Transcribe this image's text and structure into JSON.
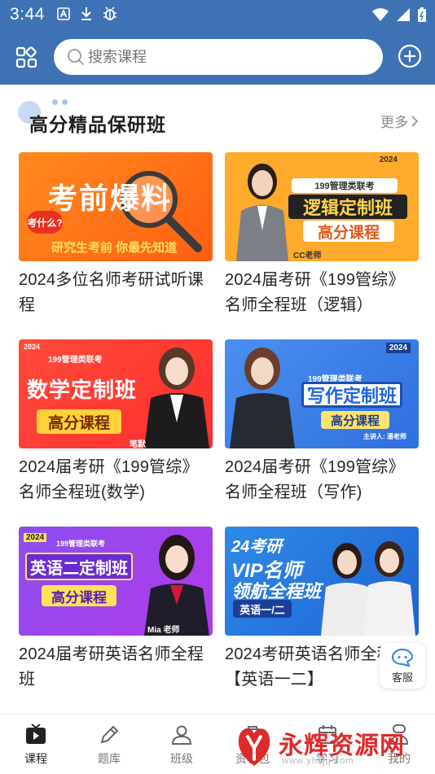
{
  "status_bar": {
    "time": "3:44",
    "left_icons": [
      "text-a-icon",
      "download-icon",
      "bug-icon"
    ],
    "right_icons": [
      "wifi-icon",
      "signal-icon",
      "battery-icon"
    ]
  },
  "header": {
    "search_placeholder": "搜索课程",
    "left_icon": "grid-icon",
    "right_icon": "add-circle-icon"
  },
  "section": {
    "title": "高分精品保研班",
    "more_label": "更多"
  },
  "courses": [
    {
      "title": "2024多位名师考研试听课程",
      "thumb": {
        "main": "考前爆料",
        "sub": "研究生考前 你最先知道",
        "badge": "考什么?"
      }
    },
    {
      "title": "2024届考研《199管综》名师全程班（逻辑）",
      "thumb": {
        "year": "2024",
        "top": "199管理类联考",
        "line1": "逻辑定制班",
        "line2": "高分课程",
        "teacher": "CC老师"
      }
    },
    {
      "title": "2024届考研《199管综》名师全程班(数学)",
      "thumb": {
        "year": "2024",
        "top": "199管理类联考",
        "line1": "数学定制班",
        "line2": "高分课程",
        "teacher": "笔默"
      }
    },
    {
      "title": "2024届考研《199管综》名师全程班（写作)",
      "thumb": {
        "year": "2024",
        "top": "199管理类联考",
        "line1": "写作定制班",
        "line2": "高分课程",
        "teacher": "主讲人: 潘老师"
      }
    },
    {
      "title": "2024届考研英语名师全程班",
      "thumb": {
        "year": "2024",
        "top": "199管理类联考",
        "line1": "英语二定制班",
        "line2": "高分课程",
        "teacher": "Mia 老师"
      }
    },
    {
      "title": "2024考研英语名师全程班【英语一二】",
      "thumb": {
        "l1": "24考研",
        "l2": "VIP名师",
        "l3": "领航全程班",
        "tag": "英语一/二"
      }
    }
  ],
  "service": {
    "label": "客服",
    "icon": "chat-bubble-icon"
  },
  "bottom_nav": [
    {
      "label": "课程",
      "icon": "tv-icon",
      "active": true
    },
    {
      "label": "题库",
      "icon": "pencil-icon",
      "active": false
    },
    {
      "label": "班级",
      "icon": "people-icon",
      "active": false
    },
    {
      "label": "资料包",
      "icon": "package-icon",
      "active": false
    },
    {
      "label": "学习",
      "icon": "calendar-icon",
      "active": false
    },
    {
      "label": "我的",
      "icon": "user-icon",
      "active": false
    }
  ],
  "watermark": {
    "text": "永辉资源网",
    "url": "www.yhkjjj.com"
  },
  "colors": {
    "brand": "#3f72b5",
    "accent_orange": "#ff7a1a",
    "accent_red": "#e02a2a"
  }
}
